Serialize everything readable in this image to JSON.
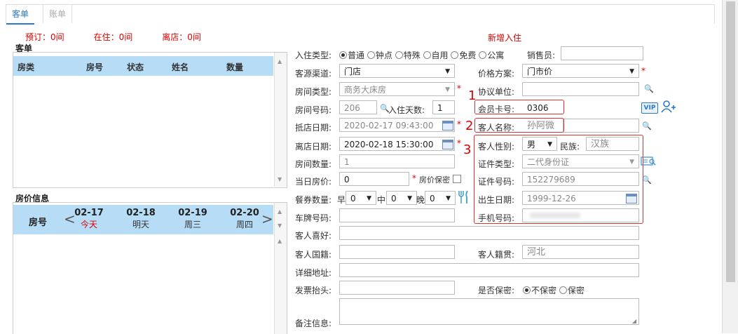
{
  "tabs": [
    {
      "label": "客单"
    },
    {
      "label": "账单"
    }
  ],
  "counts": {
    "reserved": "预订：0间",
    "staying": "在住：0间",
    "left": "离店：0间"
  },
  "page_heading": "新增入住",
  "order_panel": {
    "title": "客单",
    "columns": [
      "房类",
      "房号",
      "状态",
      "姓名",
      "数量"
    ]
  },
  "price_panel": {
    "title": "房价信息",
    "room_col": "房号",
    "dates": [
      {
        "date": "02-17",
        "weekday": "今天"
      },
      {
        "date": "02-18",
        "weekday": "明天"
      },
      {
        "date": "02-19",
        "weekday": "周三"
      },
      {
        "date": "02-20",
        "weekday": "周四"
      }
    ]
  },
  "form": {
    "checkin_type": {
      "label": "入住类型:",
      "options": [
        "普通",
        "钟点",
        "特殊",
        "自用",
        "免费",
        "公寓"
      ],
      "selected": "普通"
    },
    "salesperson": {
      "label": "销售员:",
      "value": ""
    },
    "source": {
      "label": "客源渠道:",
      "value": "门店"
    },
    "price_plan": {
      "label": "价格方案:",
      "value": "门市价"
    },
    "room_type": {
      "label": "房间类型:",
      "value": "商务大床房"
    },
    "agreement_unit": {
      "label": "协议单位:",
      "value": ""
    },
    "room_no": {
      "label": "房间号码:",
      "value": "206"
    },
    "stay_days": {
      "label": "入住天数:",
      "value": "1"
    },
    "member_card": {
      "label": "会员卡号:",
      "value": "0306"
    },
    "vip_badge": "VIP",
    "arrival": {
      "label": "抵店日期:",
      "value": "2020-02-17 09:43:00"
    },
    "guest_name": {
      "label": "客人名称:",
      "value": "孙阿微"
    },
    "departure": {
      "label": "离店日期:",
      "value": "2020-02-18 15:30:00"
    },
    "gender": {
      "label": "客人性别:",
      "value": "男"
    },
    "ethnicity": {
      "label": "民族:",
      "value": "汉族"
    },
    "room_count": {
      "label": "房间数量:",
      "value": "1"
    },
    "id_type": {
      "label": "证件类型:",
      "value": "二代身份证"
    },
    "day_price": {
      "label": "当日房价:",
      "value": "0"
    },
    "price_secret": {
      "label": "房价保密"
    },
    "id_no": {
      "label": "证件号码:",
      "value": "152279689"
    },
    "meal": {
      "label": "餐券数量:",
      "breakfast_label": "早",
      "breakfast": "0",
      "lunch_label": "中",
      "lunch": "0",
      "dinner_label": "晚",
      "dinner": "0"
    },
    "birth": {
      "label": "出生日期:",
      "value": "1999-12-26"
    },
    "plate": {
      "label": "车牌号码:",
      "value": ""
    },
    "phone": {
      "label": "手机号码:",
      "value": ""
    },
    "hobby": {
      "label": "客人喜好:",
      "value": ""
    },
    "nationality": {
      "label": "客人国籍:",
      "value": ""
    },
    "native_place": {
      "label": "客人籍贯:",
      "value": "河北"
    },
    "address": {
      "label": "详细地址:",
      "value": ""
    },
    "invoice": {
      "label": "发票抬头:",
      "value": ""
    },
    "confidential": {
      "label": "是否保密:",
      "options": [
        "不保密",
        "保密"
      ],
      "selected": "不保密"
    },
    "remarks": {
      "label": "备注信息:",
      "value": ""
    }
  },
  "annotations": [
    "1",
    "2",
    "3"
  ],
  "colors": {
    "accent": "#2a79c5",
    "required": "#dd0000",
    "grid_header": "#b6dcf6",
    "annotation": "#dd3333"
  }
}
